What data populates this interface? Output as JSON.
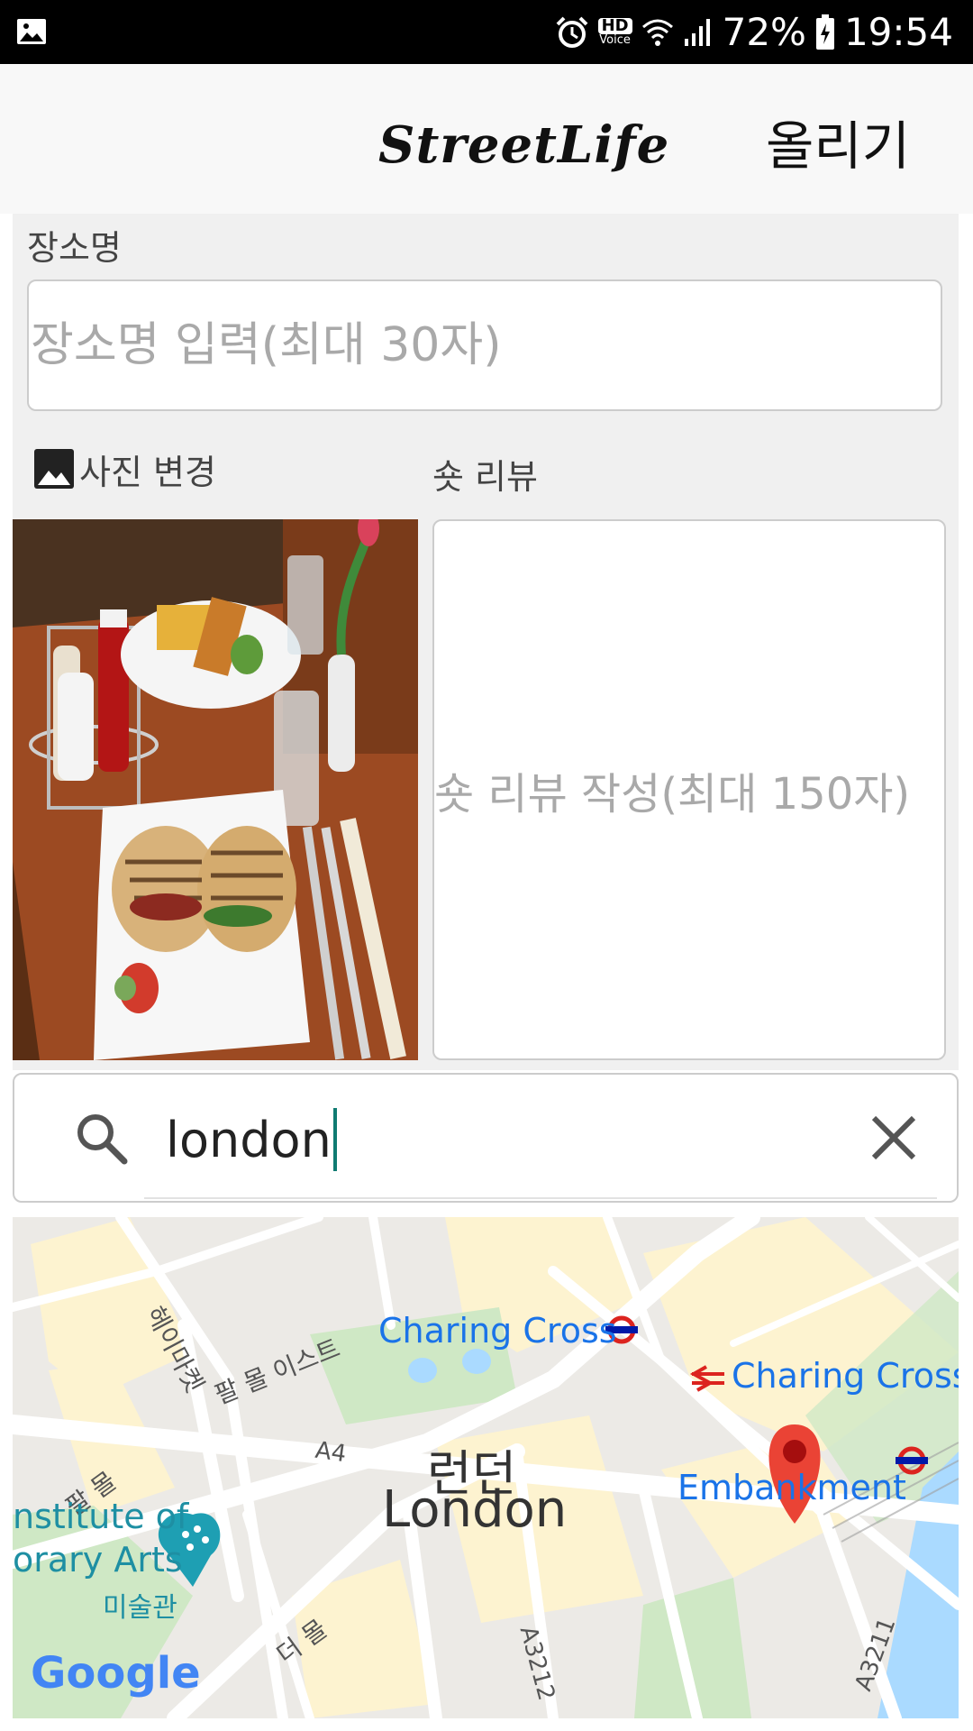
{
  "status_bar": {
    "battery": "72%",
    "time": "19:54",
    "hd_badge": "HD",
    "voice_badge": "Voice",
    "icons": [
      "gallery-icon",
      "alarm-icon",
      "hd-voice-icon",
      "wifi-icon",
      "signal-icon",
      "battery-icon"
    ]
  },
  "toolbar": {
    "logo": "StreetLife",
    "post_label": "올리기"
  },
  "form": {
    "place_label": "장소명",
    "place_placeholder": "장소명 입력(최대 30자)",
    "photo_change_label": "사진 변경",
    "short_review_label": "숏 리뷰",
    "review_placeholder": "숏 리뷰 작성(최대 150자)"
  },
  "search": {
    "value": "london"
  },
  "map": {
    "labels": {
      "charing_cross_1": "Charing Cross",
      "charing_cross_2": "Charing Cross",
      "london_ko": "런던",
      "london_en": "London",
      "embankment": "Embankment",
      "a4": "A4",
      "a3212": "A3212",
      "a3211": "A3211",
      "haymarket": "헤이마켓",
      "pall_mall_east": "팔 몰 이스트",
      "pall_mall": "팔 몰",
      "the_mall": "더 몰",
      "ica_1": "nstitute of",
      "ica_2": "orary Arts",
      "ica_3": "미술관",
      "google": "Google"
    },
    "colors": {
      "transit_text": "#1a73e8",
      "pin": "#ea4335",
      "park": "#c8e6c9",
      "water": "#aadaff",
      "museum": "#1e9fb3"
    }
  }
}
